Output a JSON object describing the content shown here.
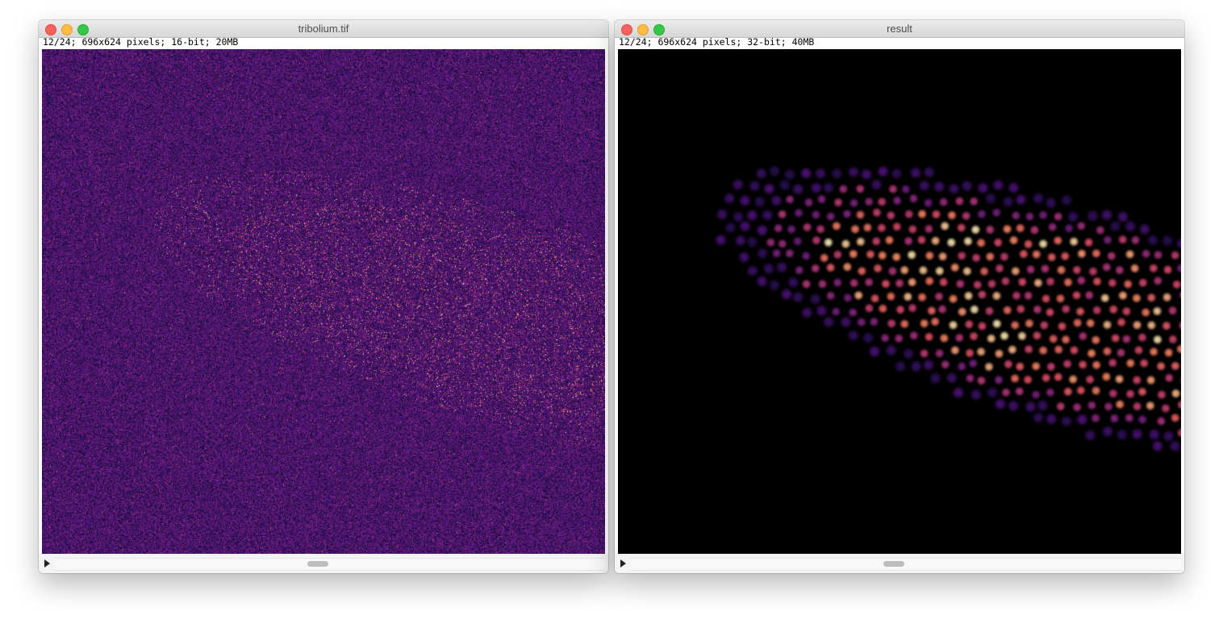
{
  "windows": [
    {
      "title": "tribolium.tif",
      "info": "12/24; 696x624 pixels; 16-bit; 20MB",
      "image_kind": "noisy-raw-fluorescence",
      "lut": "magma"
    },
    {
      "title": "result",
      "info": "12/24; 696x624 pixels; 32-bit; 40MB",
      "image_kind": "restored-nuclei",
      "lut": "magma"
    }
  ],
  "controls": {
    "play_icon": "play-triangle-icon",
    "close_icon": "close-circle-icon",
    "minimize_icon": "minimize-circle-icon",
    "zoom_icon": "zoom-circle-icon"
  },
  "colors": {
    "close": "#fc605c",
    "minimize": "#fdbc40",
    "zoom": "#34c84a",
    "lut_dark": "#000004",
    "lut_mid": "#8c2981",
    "lut_bright": "#fcfdbf"
  }
}
